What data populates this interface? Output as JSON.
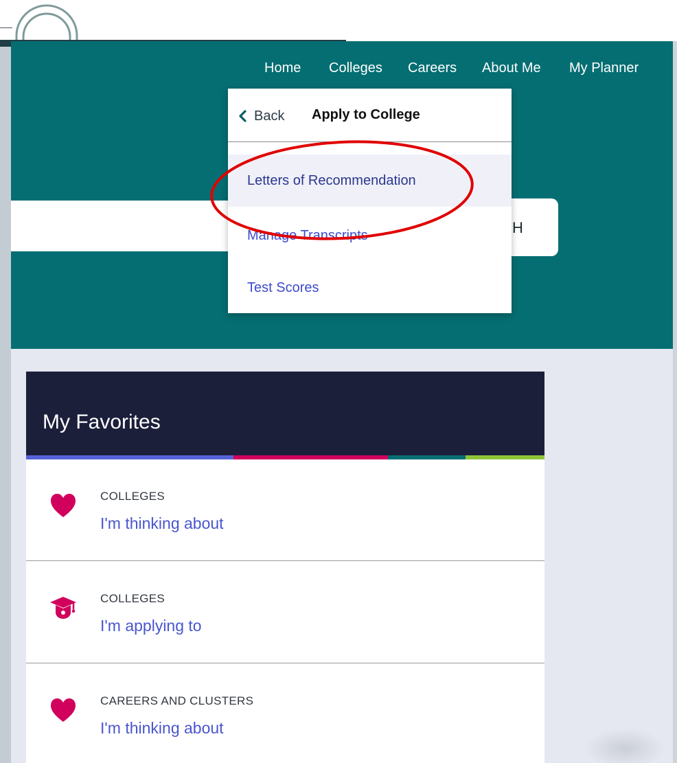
{
  "nav": {
    "items": [
      {
        "label": "Home"
      },
      {
        "label": "Colleges"
      },
      {
        "label": "Careers"
      },
      {
        "label": "About Me"
      },
      {
        "label": "My Planner"
      }
    ]
  },
  "dropdown": {
    "back_label": "Back",
    "title": "Apply to College",
    "items": [
      {
        "label": "Letters of Recommendation",
        "active": true
      },
      {
        "label": "Manage Transcripts",
        "active": false
      },
      {
        "label": "Test Scores",
        "active": false
      }
    ]
  },
  "search": {
    "button_partial_label": "H"
  },
  "favorites": {
    "title": "My Favorites",
    "rows": [
      {
        "category": "COLLEGES",
        "link": "I'm thinking about",
        "icon": "heart-icon"
      },
      {
        "category": "COLLEGES",
        "link": "I'm applying to",
        "icon": "graduation-cap-icon"
      },
      {
        "category": "CAREERS AND CLUSTERS",
        "link": "I'm thinking about",
        "icon": "heart-icon"
      }
    ]
  },
  "colors": {
    "hero_teal": "#056e72",
    "card_header_navy": "#1c1f3a",
    "link_blue": "#4a55cf",
    "icon_magenta": "#d1005d",
    "annotation_red": "#e00000",
    "strip": [
      "#5563d6",
      "#d1005d",
      "#056e72",
      "#8fc33a"
    ]
  }
}
